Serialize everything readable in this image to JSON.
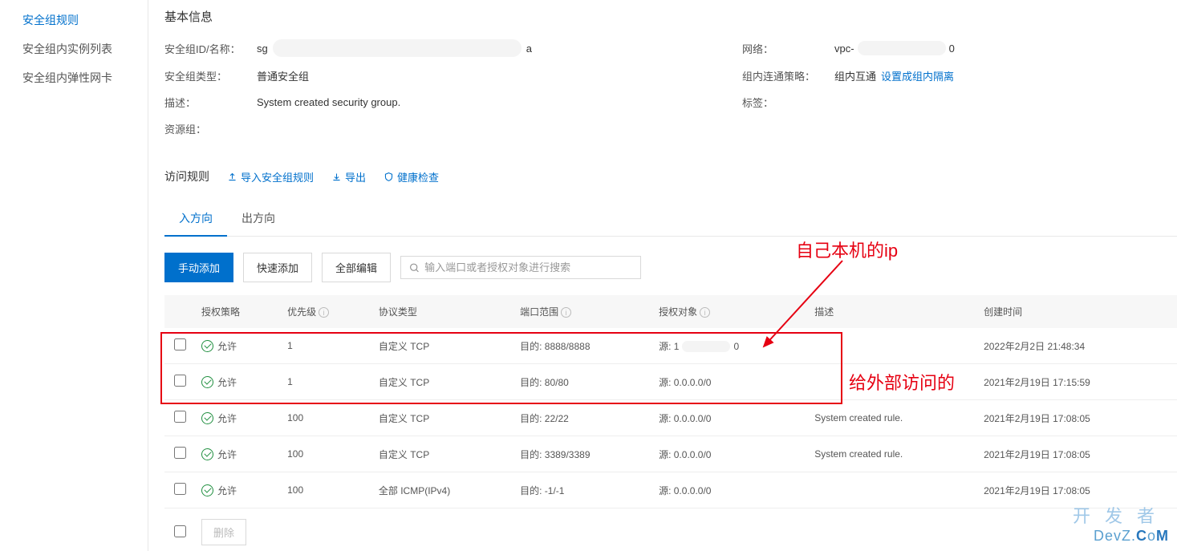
{
  "sidebar": {
    "items": [
      {
        "label": "安全组规则",
        "active": true
      },
      {
        "label": "安全组内实例列表",
        "active": false
      },
      {
        "label": "安全组内弹性网卡",
        "active": false
      }
    ]
  },
  "basic_info": {
    "title": "基本信息",
    "id_label": "安全组ID/名称",
    "id_prefix": "sg",
    "id_suffix": "a",
    "network_label": "网络",
    "network_prefix": "vpc-",
    "network_suffix": "0",
    "type_label": "安全组类型",
    "type_value": "普通安全组",
    "policy_label": "组内连通策略",
    "policy_value": "组内互通",
    "policy_link": "设置成组内隔离",
    "desc_label": "描述",
    "desc_value": "System created security group.",
    "tags_label": "标签",
    "resource_label": "资源组"
  },
  "access_rules": {
    "title": "访问规则",
    "import_label": "导入安全组规则",
    "export_label": "导出",
    "health_label": "健康检查",
    "tabs": [
      {
        "label": "入方向",
        "active": true
      },
      {
        "label": "出方向",
        "active": false
      }
    ],
    "buttons": {
      "manual_add": "手动添加",
      "quick_add": "快速添加",
      "edit_all": "全部编辑"
    },
    "search_placeholder": "输入端口或者授权对象进行搜索",
    "delete_label": "删除"
  },
  "table": {
    "headers": {
      "policy": "授权策略",
      "priority": "优先级",
      "protocol": "协议类型",
      "port": "端口范围",
      "target": "授权对象",
      "desc": "描述",
      "created": "创建时间"
    },
    "allow_text": "允许",
    "rows": [
      {
        "priority": "1",
        "protocol": "自定义 TCP",
        "port": "目的: 8888/8888",
        "target_prefix": "源: 1",
        "target_suffix": "0",
        "target_smudge": true,
        "desc": "",
        "created": "2022年2月2日 21:48:34"
      },
      {
        "priority": "1",
        "protocol": "自定义 TCP",
        "port": "目的: 80/80",
        "target": "源: 0.0.0.0/0",
        "desc": "",
        "created": "2021年2月19日 17:15:59"
      },
      {
        "priority": "100",
        "protocol": "自定义 TCP",
        "port": "目的: 22/22",
        "target": "源: 0.0.0.0/0",
        "desc": "System created rule.",
        "created": "2021年2月19日 17:08:05"
      },
      {
        "priority": "100",
        "protocol": "自定义 TCP",
        "port": "目的: 3389/3389",
        "target": "源: 0.0.0.0/0",
        "desc": "System created rule.",
        "created": "2021年2月19日 17:08:05"
      },
      {
        "priority": "100",
        "protocol": "全部 ICMP(IPv4)",
        "port": "目的: -1/-1",
        "target": "源: 0.0.0.0/0",
        "desc": "",
        "created": "2021年2月19日 17:08:05"
      }
    ]
  },
  "annotations": {
    "own_ip": "自己本机的ip",
    "external": "给外部访问的"
  },
  "watermark": {
    "cn": "开发者",
    "en_prefix": "Dev",
    "en_mid": "Z.",
    "en_c": "C",
    "en_o": "o",
    "en_m": "M"
  }
}
